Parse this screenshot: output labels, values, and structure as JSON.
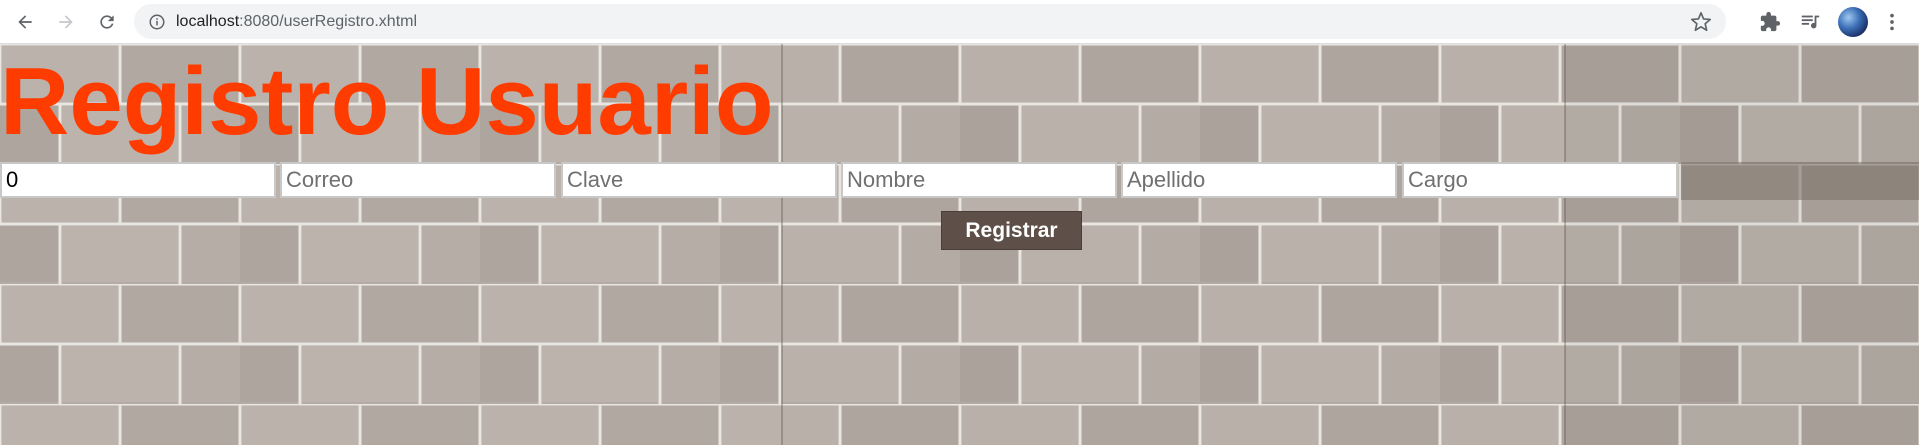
{
  "browser": {
    "url_host": "localhost",
    "url_path": ":8080/userRegistro.xhtml",
    "icons": [
      "back-icon",
      "forward-icon",
      "reload-icon",
      "info-icon",
      "star-icon",
      "extensions-icon",
      "media-queue-icon",
      "profile-avatar",
      "menu-icon"
    ]
  },
  "page": {
    "title": "Registro Usuario",
    "title_color": "#ff3c00",
    "fields": [
      {
        "name": "id",
        "value": "0",
        "placeholder": ""
      },
      {
        "name": "correo",
        "value": "",
        "placeholder": "Correo"
      },
      {
        "name": "clave",
        "value": "",
        "placeholder": "Clave"
      },
      {
        "name": "nombre",
        "value": "",
        "placeholder": "Nombre"
      },
      {
        "name": "apellido",
        "value": "",
        "placeholder": "Apellido"
      },
      {
        "name": "cargo",
        "value": "",
        "placeholder": "Cargo"
      }
    ],
    "submit_label": "Registrar",
    "button_color": "#5e5049"
  }
}
